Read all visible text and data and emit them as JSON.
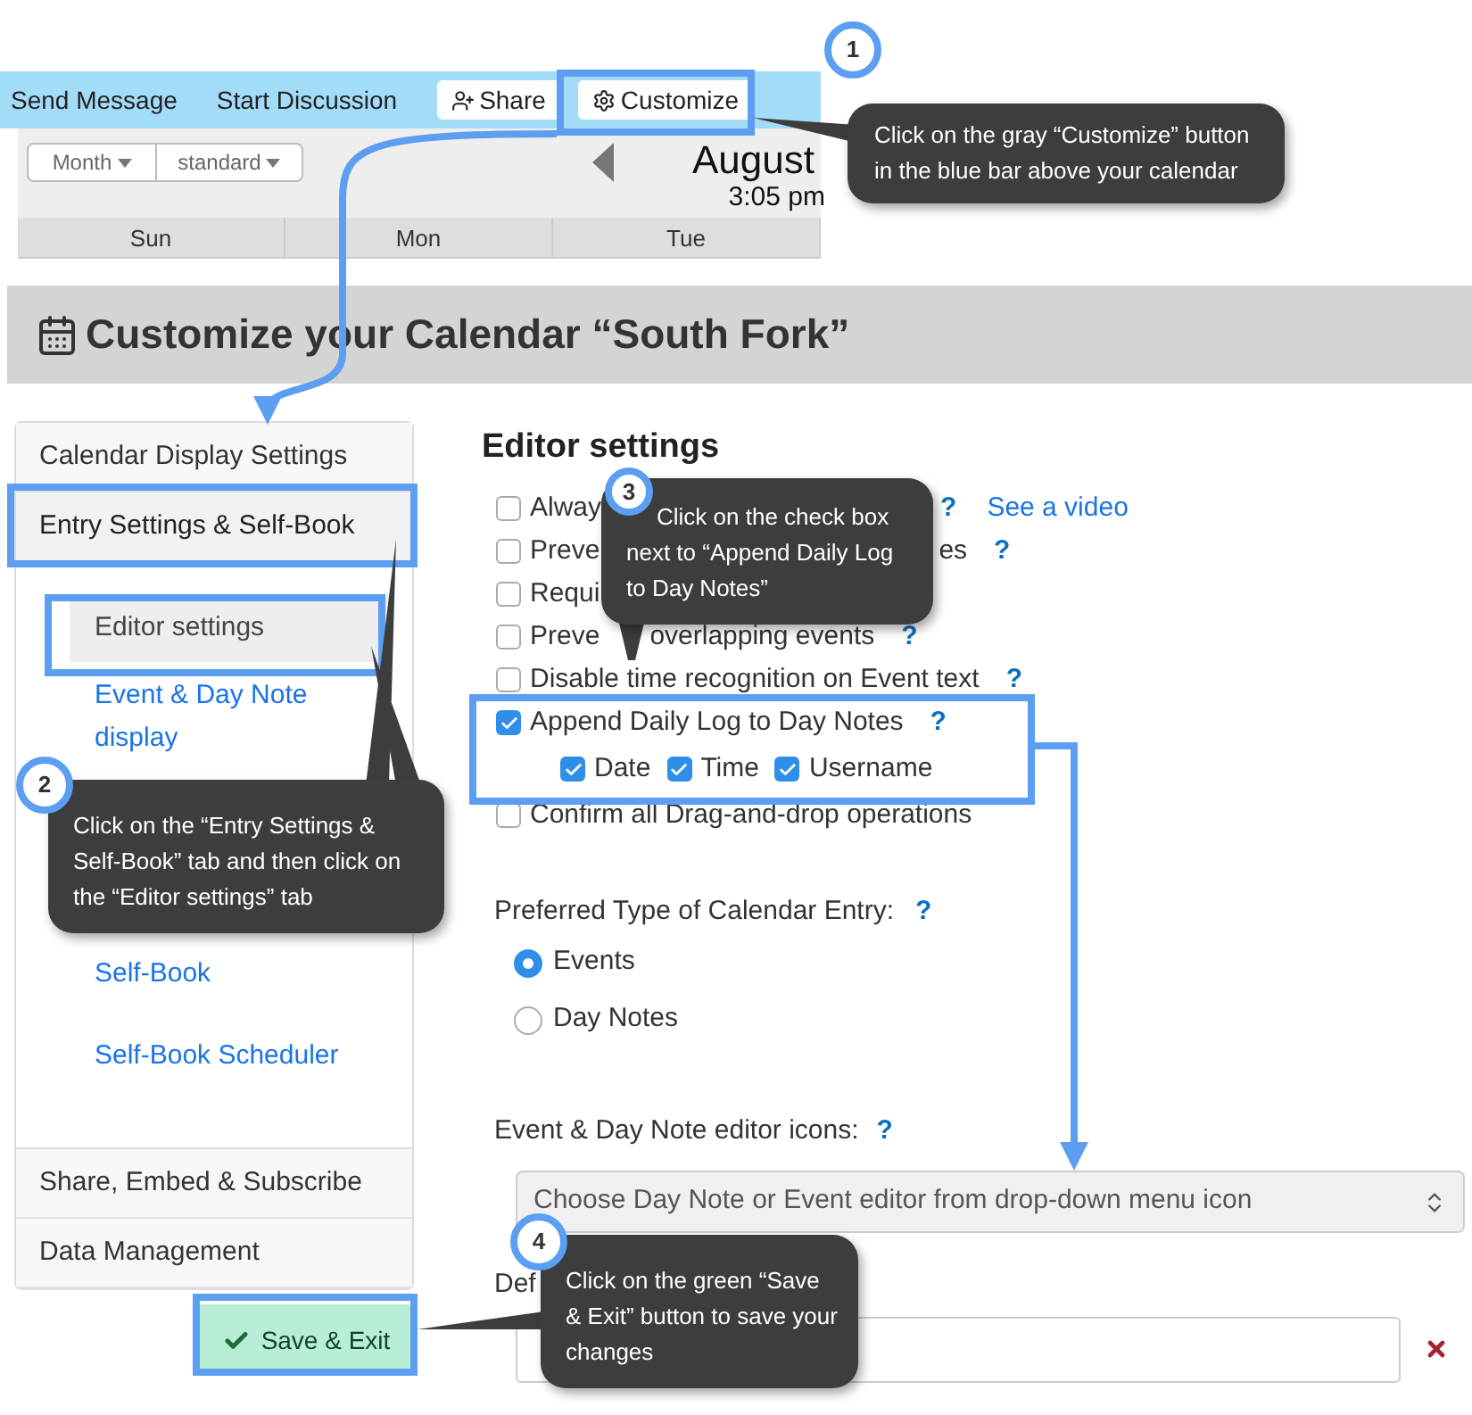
{
  "toolbar": {
    "items": [
      {
        "kind": "link",
        "label": "Send Message"
      },
      {
        "kind": "link",
        "label": "Start Discussion"
      },
      {
        "kind": "button",
        "label": "Share"
      },
      {
        "kind": "button",
        "label": "Customize"
      }
    ]
  },
  "calendar": {
    "view_buttons": [
      "Month",
      "standard"
    ],
    "month": "August",
    "time": "3:05 pm",
    "days": [
      "Sun",
      "Mon",
      "Tue"
    ]
  },
  "page_title": "Customize your Calendar “South Fork”",
  "sidebar": {
    "sections": [
      {
        "label": "Calendar Display Settings",
        "selected": false
      },
      {
        "label": "Entry Settings & Self-Book",
        "selected": true,
        "children": [
          {
            "label": "Editor settings",
            "selected": true
          },
          {
            "label": "Event & Day Note display",
            "selected": false
          },
          {
            "label": "Self-Book",
            "selected": false
          },
          {
            "label": "Self-Book Scheduler",
            "selected": false
          }
        ]
      },
      {
        "label": "Share, Embed & Subscribe",
        "selected": false
      },
      {
        "label": "Data Management",
        "selected": false
      }
    ]
  },
  "save_button": "Save & Exit",
  "editor": {
    "heading": "Editor settings",
    "options": [
      {
        "label": "Alway",
        "checked": false,
        "help": "?",
        "link": "See a video"
      },
      {
        "label": "Preve",
        "tail": "es",
        "checked": false,
        "help": "?"
      },
      {
        "label": "Requi",
        "checked": false
      },
      {
        "label": "Preve",
        "tail": "overlapping events",
        "checked": false,
        "help": "?"
      },
      {
        "label": "Disable time recognition on Event text",
        "checked": false,
        "help": "?"
      },
      {
        "label": "Append Daily Log to Day Notes",
        "checked": true,
        "help": "?",
        "suboptions": [
          {
            "label": "Date",
            "checked": true
          },
          {
            "label": "Time",
            "checked": true
          },
          {
            "label": "Username",
            "checked": true
          }
        ]
      },
      {
        "label": "Confirm all Drag-and-drop operations",
        "checked": false
      }
    ],
    "entry_type": {
      "label": "Preferred Type of Calendar Entry:",
      "help": "?",
      "options": [
        {
          "label": "Events",
          "selected": true
        },
        {
          "label": "Day Notes",
          "selected": false
        }
      ]
    },
    "editor_icons": {
      "label": "Event & Day Note editor icons:",
      "help": "?",
      "value": "Choose Day Note or Event editor from drop-down menu icon"
    },
    "default_field": {
      "label": "Def"
    }
  },
  "callouts": [
    {
      "step": "1",
      "text": "Click on the gray “Customize” button in the blue bar above your calendar"
    },
    {
      "step": "2",
      "text": "Click on the “Entry Settings & Self-Book” tab and then click on the “Editor settings” tab"
    },
    {
      "step": "3",
      "text": "Click on the check box next to “Append Daily Log to Day Notes”"
    },
    {
      "step": "4",
      "text": "Click on the green “Save & Exit” button to save your changes"
    }
  ]
}
